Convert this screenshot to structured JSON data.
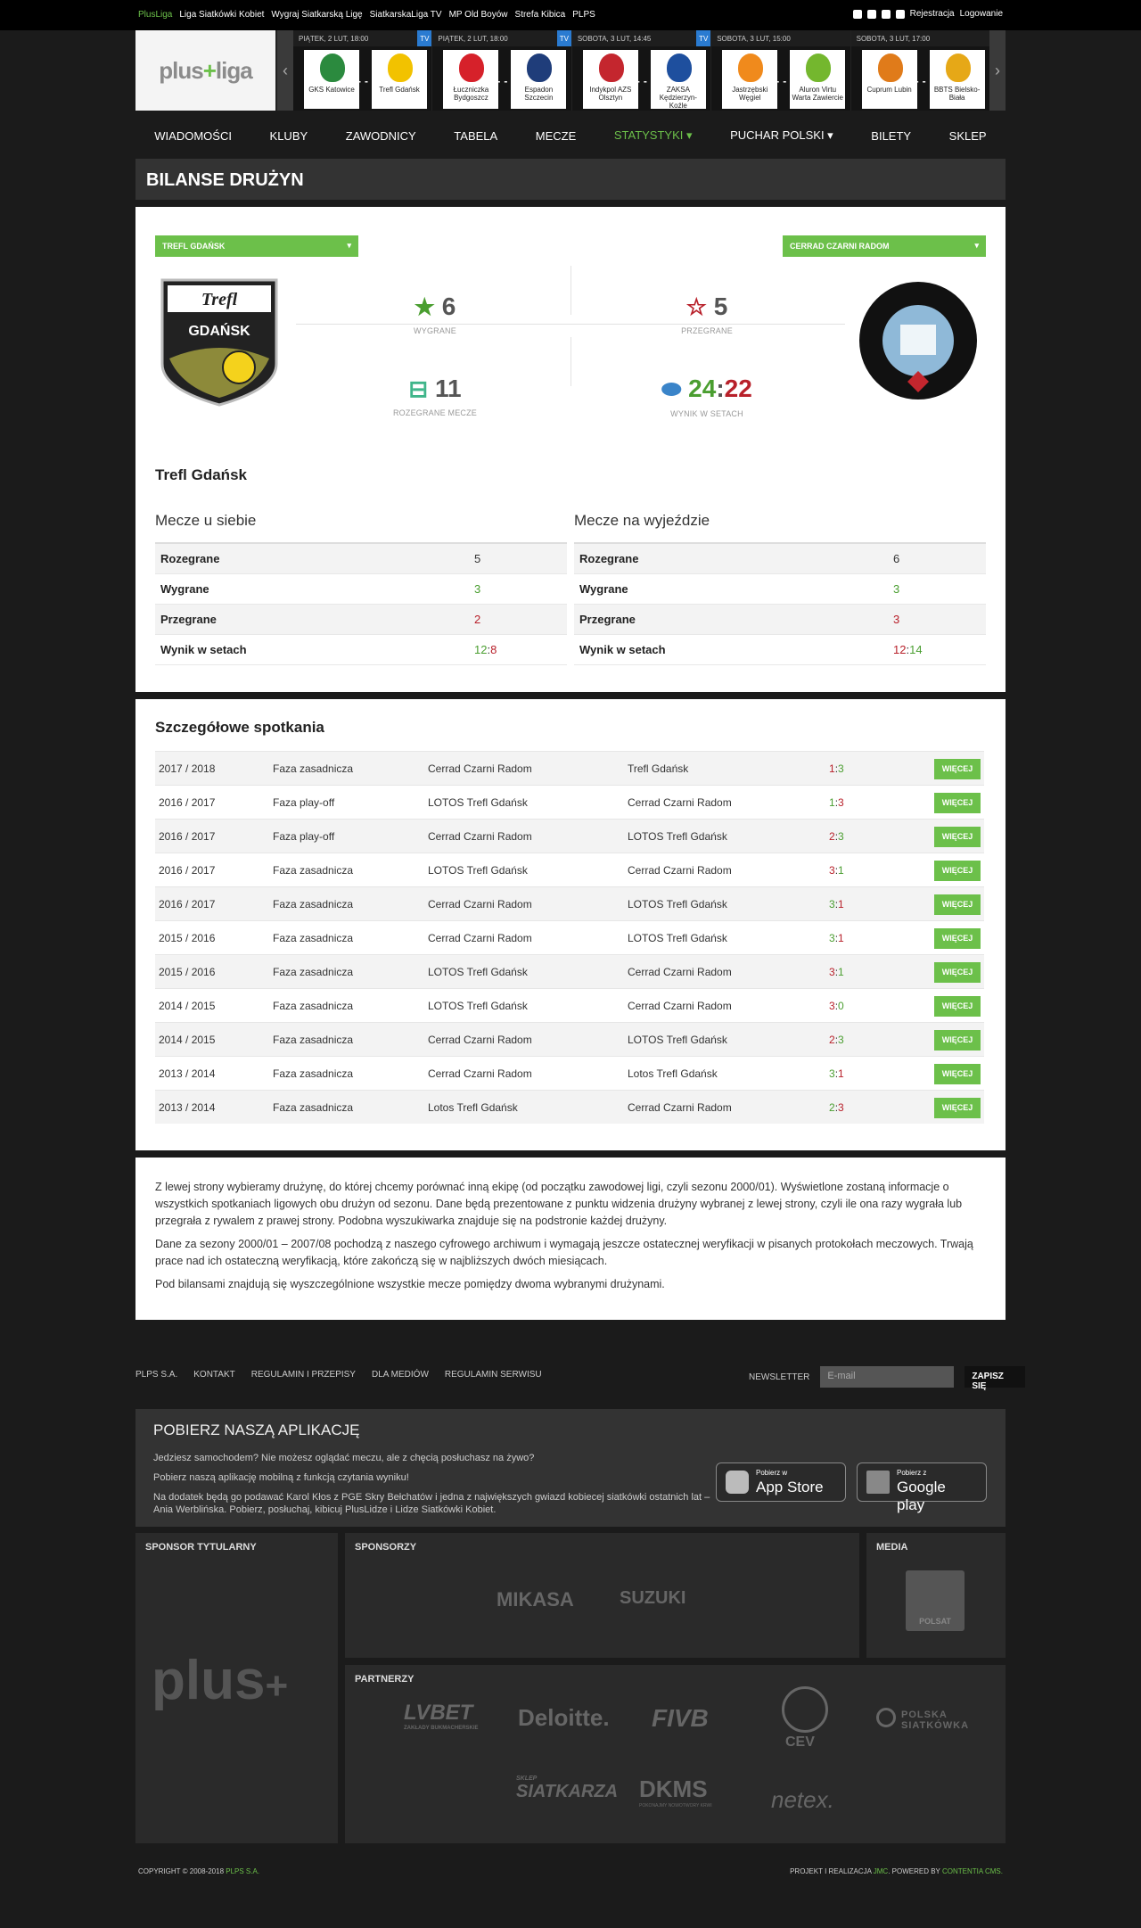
{
  "topbar": {
    "links": [
      "PlusLiga",
      "Liga Siatkówki Kobiet",
      "Wygraj Siatkarską Ligę",
      "SiatkarskaLiga TV",
      "MP Old Boyów",
      "Strefa Kibica",
      "PLPS"
    ],
    "register": "Rejestracja",
    "login": "Logowanie"
  },
  "logo": {
    "text_a": "plus",
    "text_b": "liga"
  },
  "matches": [
    {
      "date": "PIĄTEK, 2 LUT, 18:00",
      "tv": "TV",
      "home": "GKS Katowice",
      "away": "Trefl Gdańsk",
      "home_color": "#2b8a3e",
      "away_color": "#f2c200"
    },
    {
      "date": "PIĄTEK, 2 LUT, 18:00",
      "tv": "TV",
      "home": "Łuczniczka Bydgoszcz",
      "away": "Espadon Szczecin",
      "home_color": "#d6212a",
      "away_color": "#1f3d7a"
    },
    {
      "date": "SOBOTA, 3 LUT, 14:45",
      "tv": "TV",
      "home": "Indykpol AZS Olsztyn",
      "away": "ZAKSA Kędzierzyn-Koźle",
      "home_color": "#c4262e",
      "away_color": "#1e4f9e"
    },
    {
      "date": "SOBOTA, 3 LUT, 15:00",
      "tv": "",
      "home": "Jastrzębski Węgiel",
      "away": "Aluron Virtu Warta Zawiercie",
      "home_color": "#f08a1c",
      "away_color": "#74b72e"
    },
    {
      "date": "SOBOTA, 3 LUT, 17:00",
      "tv": "",
      "home": "Cuprum Lubin",
      "away": "BBTS Bielsko-Biała",
      "home_color": "#e07b1a",
      "away_color": "#e6a817"
    }
  ],
  "nav": [
    "WIADOMOŚCI",
    "KLUBY",
    "ZAWODNICY",
    "TABELA",
    "MECZE",
    "STATYSTYKI ▾",
    "PUCHAR POLSKI ▾",
    "BILETY",
    "SKLEP"
  ],
  "page_title": "BILANSE DRUŻYN",
  "selectors": {
    "left": "TREFL GDAŃSK",
    "right": "CERRAD CZARNI RADOM"
  },
  "stats": {
    "won": "6",
    "won_label": "WYGRANE",
    "lost": "5",
    "lost_label": "PRZEGRANE",
    "played": "11",
    "played_label": "ROZEGRANE MECZE",
    "sets_won": "24",
    "sets_sep": ":",
    "sets_lost": "22",
    "sets_label": "WYNIK W SETACH"
  },
  "team_name": "Trefl Gdańsk",
  "home": {
    "heading": "Mecze u siebie",
    "rows": [
      {
        "k": "Rozegrane",
        "v": "5"
      },
      {
        "k": "Wygrane",
        "v": "3"
      },
      {
        "k": "Przegrane",
        "v": "2"
      },
      {
        "k": "Wynik w setach",
        "a": "12",
        "sep": ":",
        "b": "8"
      }
    ]
  },
  "away": {
    "heading": "Mecze na wyjeździe",
    "rows": [
      {
        "k": "Rozegrane",
        "v": "6"
      },
      {
        "k": "Wygrane",
        "v": "3"
      },
      {
        "k": "Przegrane",
        "v": "3"
      },
      {
        "k": "Wynik w setach",
        "a": "12",
        "sep": ":",
        "b": "14"
      }
    ]
  },
  "details": {
    "heading": "Szczegółowe spotkania",
    "button": "WIĘCEJ",
    "rows": [
      {
        "season": "2017 / 2018",
        "phase": "Faza zasadnicza",
        "home": "Cerrad Czarni Radom",
        "away": "Trefl Gdańsk",
        "a": "1",
        "b": "3",
        "win": true
      },
      {
        "season": "2016 / 2017",
        "phase": "Faza play-off",
        "home": "LOTOS Trefl Gdańsk",
        "away": "Cerrad Czarni Radom",
        "a": "1",
        "b": "3",
        "win": false
      },
      {
        "season": "2016 / 2017",
        "phase": "Faza play-off",
        "home": "Cerrad Czarni Radom",
        "away": "LOTOS Trefl Gdańsk",
        "a": "2",
        "b": "3",
        "win": true
      },
      {
        "season": "2016 / 2017",
        "phase": "Faza zasadnicza",
        "home": "LOTOS Trefl Gdańsk",
        "away": "Cerrad Czarni Radom",
        "a": "3",
        "b": "1",
        "win": true
      },
      {
        "season": "2016 / 2017",
        "phase": "Faza zasadnicza",
        "home": "Cerrad Czarni Radom",
        "away": "LOTOS Trefl Gdańsk",
        "a": "3",
        "b": "1",
        "win": false
      },
      {
        "season": "2015 / 2016",
        "phase": "Faza zasadnicza",
        "home": "Cerrad Czarni Radom",
        "away": "LOTOS Trefl Gdańsk",
        "a": "3",
        "b": "1",
        "win": false
      },
      {
        "season": "2015 / 2016",
        "phase": "Faza zasadnicza",
        "home": "LOTOS Trefl Gdańsk",
        "away": "Cerrad Czarni Radom",
        "a": "3",
        "b": "1",
        "win": true
      },
      {
        "season": "2014 / 2015",
        "phase": "Faza zasadnicza",
        "home": "LOTOS Trefl Gdańsk",
        "away": "Cerrad Czarni Radom",
        "a": "3",
        "b": "0",
        "win": true
      },
      {
        "season": "2014 / 2015",
        "phase": "Faza zasadnicza",
        "home": "Cerrad Czarni Radom",
        "away": "LOTOS Trefl Gdańsk",
        "a": "2",
        "b": "3",
        "win": true
      },
      {
        "season": "2013 / 2014",
        "phase": "Faza zasadnicza",
        "home": "Cerrad Czarni Radom",
        "away": "Lotos Trefl Gdańsk",
        "a": "3",
        "b": "1",
        "win": false
      },
      {
        "season": "2013 / 2014",
        "phase": "Faza zasadnicza",
        "home": "Lotos Trefl Gdańsk",
        "away": "Cerrad Czarni Radom",
        "a": "2",
        "b": "3",
        "win": false
      }
    ]
  },
  "info": [
    "Z lewej strony wybieramy drużynę, do której chcemy porównać inną ekipę (od początku zawodowej ligi, czyli sezonu 2000/01). Wyświetlone zostaną informacje o wszystkich spotkaniach ligowych obu drużyn od sezonu. Dane będą prezentowane z punktu widzenia drużyny wybranej z lewej strony, czyli ile ona razy wygrała lub przegrała z rywalem z prawej strony. Podobna wyszukiwarka znajduje się na podstronie każdej drużyny.",
    "Dane za sezony 2000/01 – 2007/08 pochodzą z naszego cyfrowego archiwum i wymagają jeszcze ostatecznej weryfikacji w pisanych protokołach meczowych. Trwają prace nad ich ostateczną weryfikacją, które zakończą się w najbliższych dwóch miesiącach.",
    "Pod bilansami znajdują się wyszczególnione wszystkie mecze pomiędzy dwoma wybranymi drużynami."
  ],
  "footer": {
    "links": [
      "PLPS S.A.",
      "KONTAKT",
      "REGULAMIN I PRZEPISY",
      "DLA MEDIÓW",
      "REGULAMIN SERWISU"
    ],
    "newsletter": "NEWSLETTER",
    "email_placeholder": "E-mail",
    "subscribe": "ZAPISZ SIĘ"
  },
  "app": {
    "title": "POBIERZ NASZĄ APLIKACJĘ",
    "p1": "Jedziesz samochodem? Nie możesz oglądać meczu, ale z chęcią posłuchasz na żywo?",
    "p2": "Pobierz naszą aplikację mobilną z funkcją czytania wyniku!",
    "p3": "Na dodatek będą go podawać Karol Kłos z PGE Skry Bełchatów i jedna z największych gwiazd kobiecej siatkówki ostatnich lat – Ania Werblińska. Pobierz, posłuchaj, kibicuj PlusLidze i Lidze Siatkówki Kobiet.",
    "appstore_small": "Pobierz w",
    "appstore": "App Store",
    "gplay_small": "Pobierz z",
    "gplay": "Google play"
  },
  "sponsors": {
    "title_sponsor": "SPONSOR TYTULARNY",
    "sponsors": "SPONSORZY",
    "media": "MEDIA",
    "partners": "PARTNERZY",
    "plus": "plus",
    "mikasa": "MIKASA",
    "suzuki": "SUZUKI",
    "polsat": "POLSAT",
    "lvbet": "LVBET",
    "lvbet_sub": "ZAKŁADY BUKMACHERSKIE",
    "deloitte": "Deloitte.",
    "fivb": "FIVB",
    "cev": "CEV",
    "pzps": "POLSKA SIATKÓWKA",
    "sklep": "SIATKARZA",
    "sklep_small": "SKLEP",
    "dkms": "DKMS",
    "dkms_sub": "POKONAJMY NOWOTWORY KRWI",
    "netex": "netex."
  },
  "copyright": {
    "text": "COPYRIGHT © 2008-2018",
    "org": "PLPS S.A.",
    "proj": "PROJEKT I REALIZACJA",
    "jmc": "JMC",
    "powered": ". POWERED BY",
    "cms": "CONTENTIA CMS."
  },
  "colors": {
    "accent": "#6cc04a",
    "win": "#4a9e30",
    "loss": "#b8202a"
  }
}
